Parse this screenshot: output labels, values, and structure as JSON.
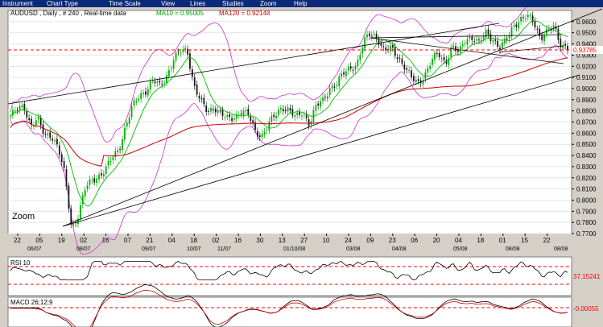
{
  "menu": [
    "Instrument",
    "Chart Type",
    "Time Scale",
    "View",
    "Lines",
    "Studies",
    "Zoom",
    "Help"
  ],
  "main": {
    "header_symbol": "AUDUSD , Daily , # 240 , Real-time data",
    "ma10_label": "MA10 = 0.95005",
    "ma120_label": "MA120 = 0.92148",
    "current_price": "0.93785",
    "zoom_label": "Zoom",
    "y_ticks": [
      "0.9600",
      "0.9500",
      "0.9400",
      "0.9300",
      "0.9200",
      "0.9100",
      "0.9000",
      "0.8900",
      "0.8800",
      "0.8700",
      "0.8600",
      "0.8500",
      "0.8400",
      "0.8300",
      "0.8200",
      "0.8100",
      "0.8000",
      "0.7900",
      "0.7800",
      "0.7700"
    ],
    "x_day_ticks": [
      "22",
      "05",
      "19",
      "02",
      "16",
      "07",
      "21",
      "04",
      "18",
      "02",
      "16",
      "30",
      "13",
      "27",
      "10",
      "24",
      "09",
      "23",
      "06",
      "20",
      "04",
      "18",
      "01",
      "15",
      "22"
    ],
    "x_month_ticks": [
      "06/07",
      "08/07",
      "09/07",
      "10/07",
      "11/07",
      "01/10/08",
      "03/08",
      "04/08",
      "05/08",
      "08/08",
      "08/08"
    ],
    "colors": {
      "bg": "#ffffff",
      "up": "#00b000",
      "down": "#1a1a1a",
      "ma10": "#00c000",
      "ma120": "#d00000",
      "bands": "#cc33cc",
      "trend": "#000000",
      "ref": "#ff0000"
    }
  },
  "rsi": {
    "label": "RSI 10",
    "value": "37.15241"
  },
  "macd": {
    "label": "MACD 26;12;9",
    "value": "-0.00055"
  },
  "chart_data": {
    "type": "candlestick",
    "ylim": [
      0.77,
      0.97
    ],
    "yticks": [
      0.96,
      0.95,
      0.94,
      0.93,
      0.92,
      0.91,
      0.9,
      0.89,
      0.88,
      0.87,
      0.86,
      0.85,
      0.84,
      0.83,
      0.82,
      0.81,
      0.8,
      0.79,
      0.78,
      0.77
    ],
    "close_path": [
      0.875,
      0.881,
      0.884,
      0.867,
      0.872,
      0.858,
      0.859,
      0.847,
      0.822,
      0.775,
      0.787,
      0.81,
      0.818,
      0.822,
      0.827,
      0.838,
      0.847,
      0.867,
      0.884,
      0.894,
      0.899,
      0.907,
      0.902,
      0.912,
      0.926,
      0.933,
      0.935,
      0.903,
      0.888,
      0.879,
      0.884,
      0.877,
      0.872,
      0.875,
      0.88,
      0.876,
      0.862,
      0.858,
      0.868,
      0.876,
      0.884,
      0.881,
      0.873,
      0.879,
      0.869,
      0.884,
      0.889,
      0.901,
      0.904,
      0.913,
      0.919,
      0.922,
      0.941,
      0.95,
      0.946,
      0.933,
      0.936,
      0.929,
      0.92,
      0.909,
      0.905,
      0.913,
      0.925,
      0.931,
      0.923,
      0.938,
      0.931,
      0.945,
      0.946,
      0.94,
      0.95,
      0.945,
      0.936,
      0.943,
      0.957,
      0.962,
      0.964,
      0.96,
      0.946,
      0.951,
      0.955,
      0.94,
      0.937
    ],
    "reference_price": 0.93785,
    "rsi_value": 37.15241,
    "macd_value": -0.00055
  }
}
